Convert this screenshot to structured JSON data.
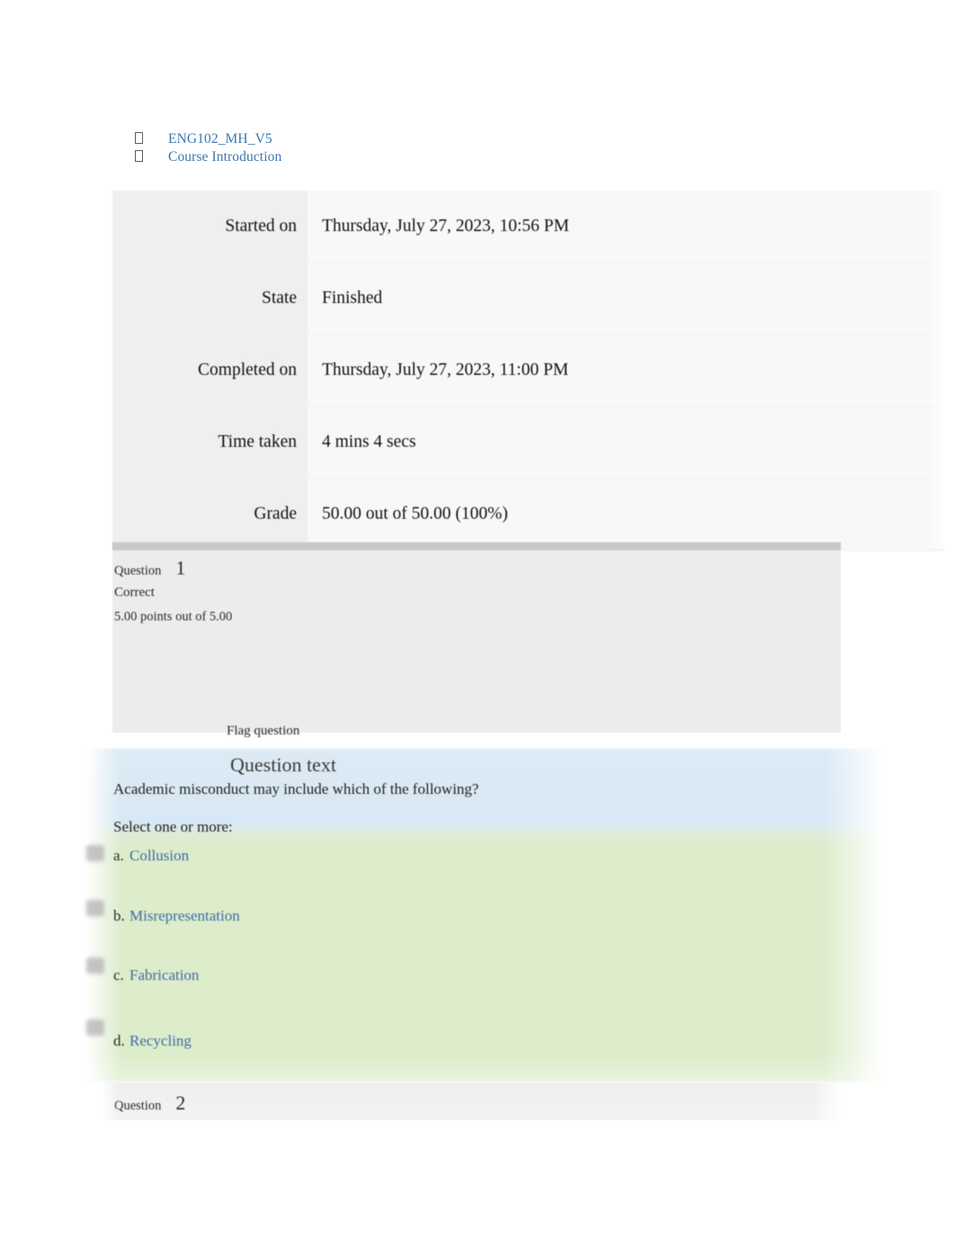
{
  "breadcrumb": {
    "glyph": "missing-glyph-box",
    "items": [
      {
        "label": "ENG102_MH_V5"
      },
      {
        "label": "Course Introduction"
      }
    ]
  },
  "attempt_info": {
    "rows": [
      {
        "label": "Started on",
        "value": "Thursday, July 27, 2023, 10:56 PM"
      },
      {
        "label": "State",
        "value": "Finished"
      },
      {
        "label": "Completed on",
        "value": "Thursday, July 27, 2023, 11:00 PM"
      },
      {
        "label": "Time taken",
        "value": "4 mins 4 secs"
      },
      {
        "label": "Grade",
        "value": "50.00 out of 50.00 (100%)"
      }
    ]
  },
  "question_one": {
    "question_word": "Question",
    "number": "1",
    "state": "Correct",
    "points": "5.00 points out of 5.00",
    "flag_label": "Flag question",
    "heading": "Question text",
    "prompt": "Academic misconduct may include which of the following?",
    "select_hint": "Select one or more:",
    "answers": [
      {
        "letter": "a.",
        "label": "Collusion"
      },
      {
        "letter": "b.",
        "label": "Misrepresentation"
      },
      {
        "letter": "c.",
        "label": "Fabrication"
      },
      {
        "letter": "d.",
        "label": "Recycling"
      }
    ]
  },
  "question_two": {
    "question_word": "Question",
    "number": "2"
  },
  "colors": {
    "link": "#3d77ab",
    "answer_link": "#3d6ea5",
    "question_text_bg": "#d8e9f5",
    "answer_bg": "#ddeccb",
    "info_label_bg": "#efefef",
    "info_value_bg": "#f8f8f8",
    "question_block_bg": "#ececec",
    "question_topbar": "#c9c9c9"
  }
}
